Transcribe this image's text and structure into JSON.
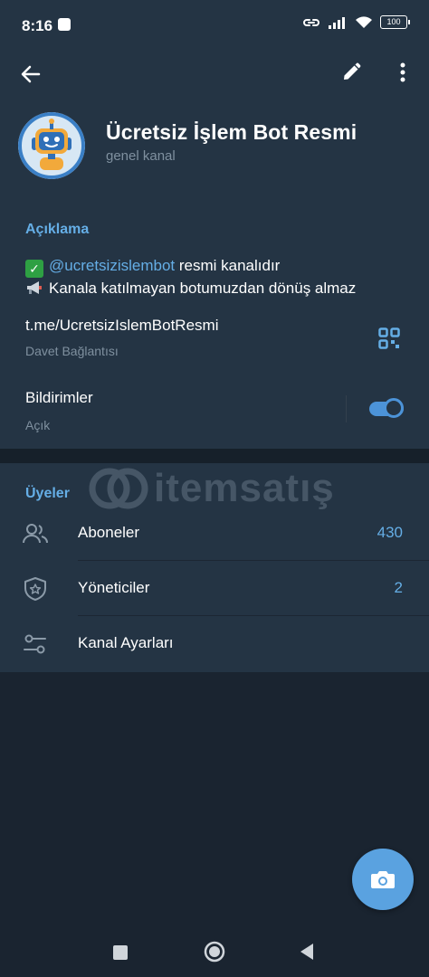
{
  "status": {
    "time": "8:16",
    "battery": "100"
  },
  "header": {
    "title": "Ücretsiz İşlem Bot Resmi",
    "subtitle": "genel kanal"
  },
  "info": {
    "section_title": "Açıklama",
    "description_line1_mention": "@ucretsizislembot",
    "description_line1_rest": " resmi kanalıdır",
    "description_line2": "Kanala katılmayan botumuzdan dönüş almaz",
    "invite_link": "t.me/UcretsizIslemBotResmi",
    "invite_link_caption": "Davet Bağlantısı",
    "notifications_label": "Bildirimler",
    "notifications_state": "Açık",
    "notifications_on": true
  },
  "members": {
    "section_title": "Üyeler",
    "items": [
      {
        "label": "Aboneler",
        "count": "430",
        "icon": "people-icon"
      },
      {
        "label": "Yöneticiler",
        "count": "2",
        "icon": "admin-shield-icon"
      },
      {
        "label": "Kanal Ayarları",
        "count": "",
        "icon": "sliders-icon"
      }
    ]
  },
  "watermark": {
    "text": "itemsatış"
  },
  "colors": {
    "background": "#1a2430",
    "card": "#243444",
    "accent": "#65aee6",
    "fab": "#5aa2e0",
    "muted_text": "#7f909f"
  }
}
